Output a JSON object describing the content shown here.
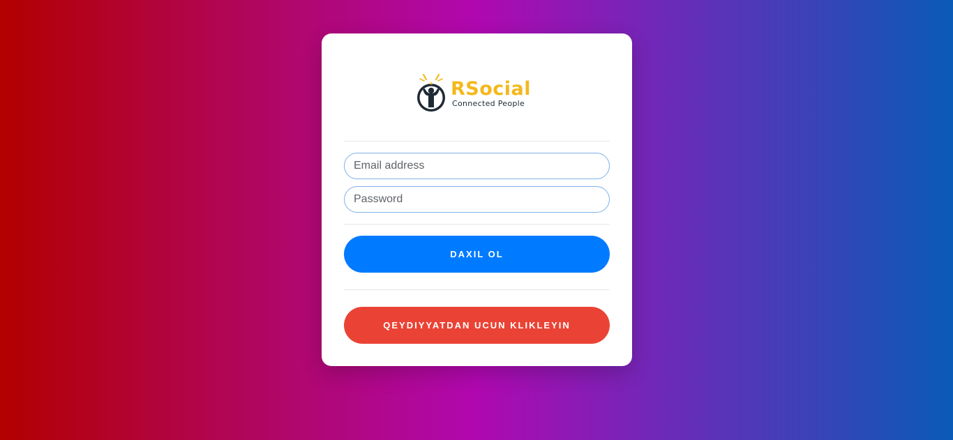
{
  "logo": {
    "name": "RSocial",
    "tagline": "Connected People"
  },
  "form": {
    "email_placeholder": "Email address",
    "email_value": "",
    "password_placeholder": "Password",
    "password_value": "",
    "login_label": "DAXIL OL",
    "register_label": "QEYDIYYATDAN UCUN KLIKLEYIN"
  },
  "colors": {
    "brand_yellow": "#f4b81c",
    "brand_dark": "#1e2a36",
    "login_button": "#007bff",
    "register_button": "#ea4335",
    "input_border": "#7fb0e8"
  }
}
